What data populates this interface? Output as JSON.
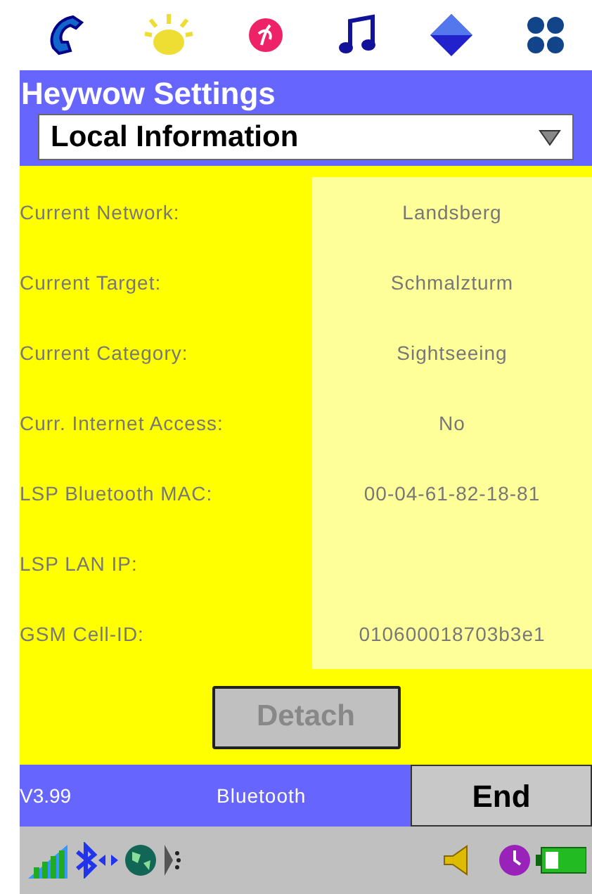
{
  "app_bar": {
    "title": "Heywow Settings"
  },
  "dropdown": {
    "value": "Local Information"
  },
  "fields": [
    {
      "label": "Current Network:",
      "value": "Landsberg"
    },
    {
      "label": "Current Target:",
      "value": "Schmalzturm"
    },
    {
      "label": "Current Category:",
      "value": "Sightseeing"
    },
    {
      "label": "Curr. Internet Access:",
      "value": "No"
    },
    {
      "label": "LSP Bluetooth MAC:",
      "value": "00-04-61-82-18-81"
    },
    {
      "label": "LSP LAN IP:"
    },
    {
      "label": "GSM Cell-ID:",
      "value": "010600018703b3e1"
    }
  ],
  "detach_button": {
    "label": "Detach",
    "disabled": true
  },
  "footer": {
    "version": "V3.99",
    "connection": "Bluetooth",
    "end_button": "End"
  }
}
